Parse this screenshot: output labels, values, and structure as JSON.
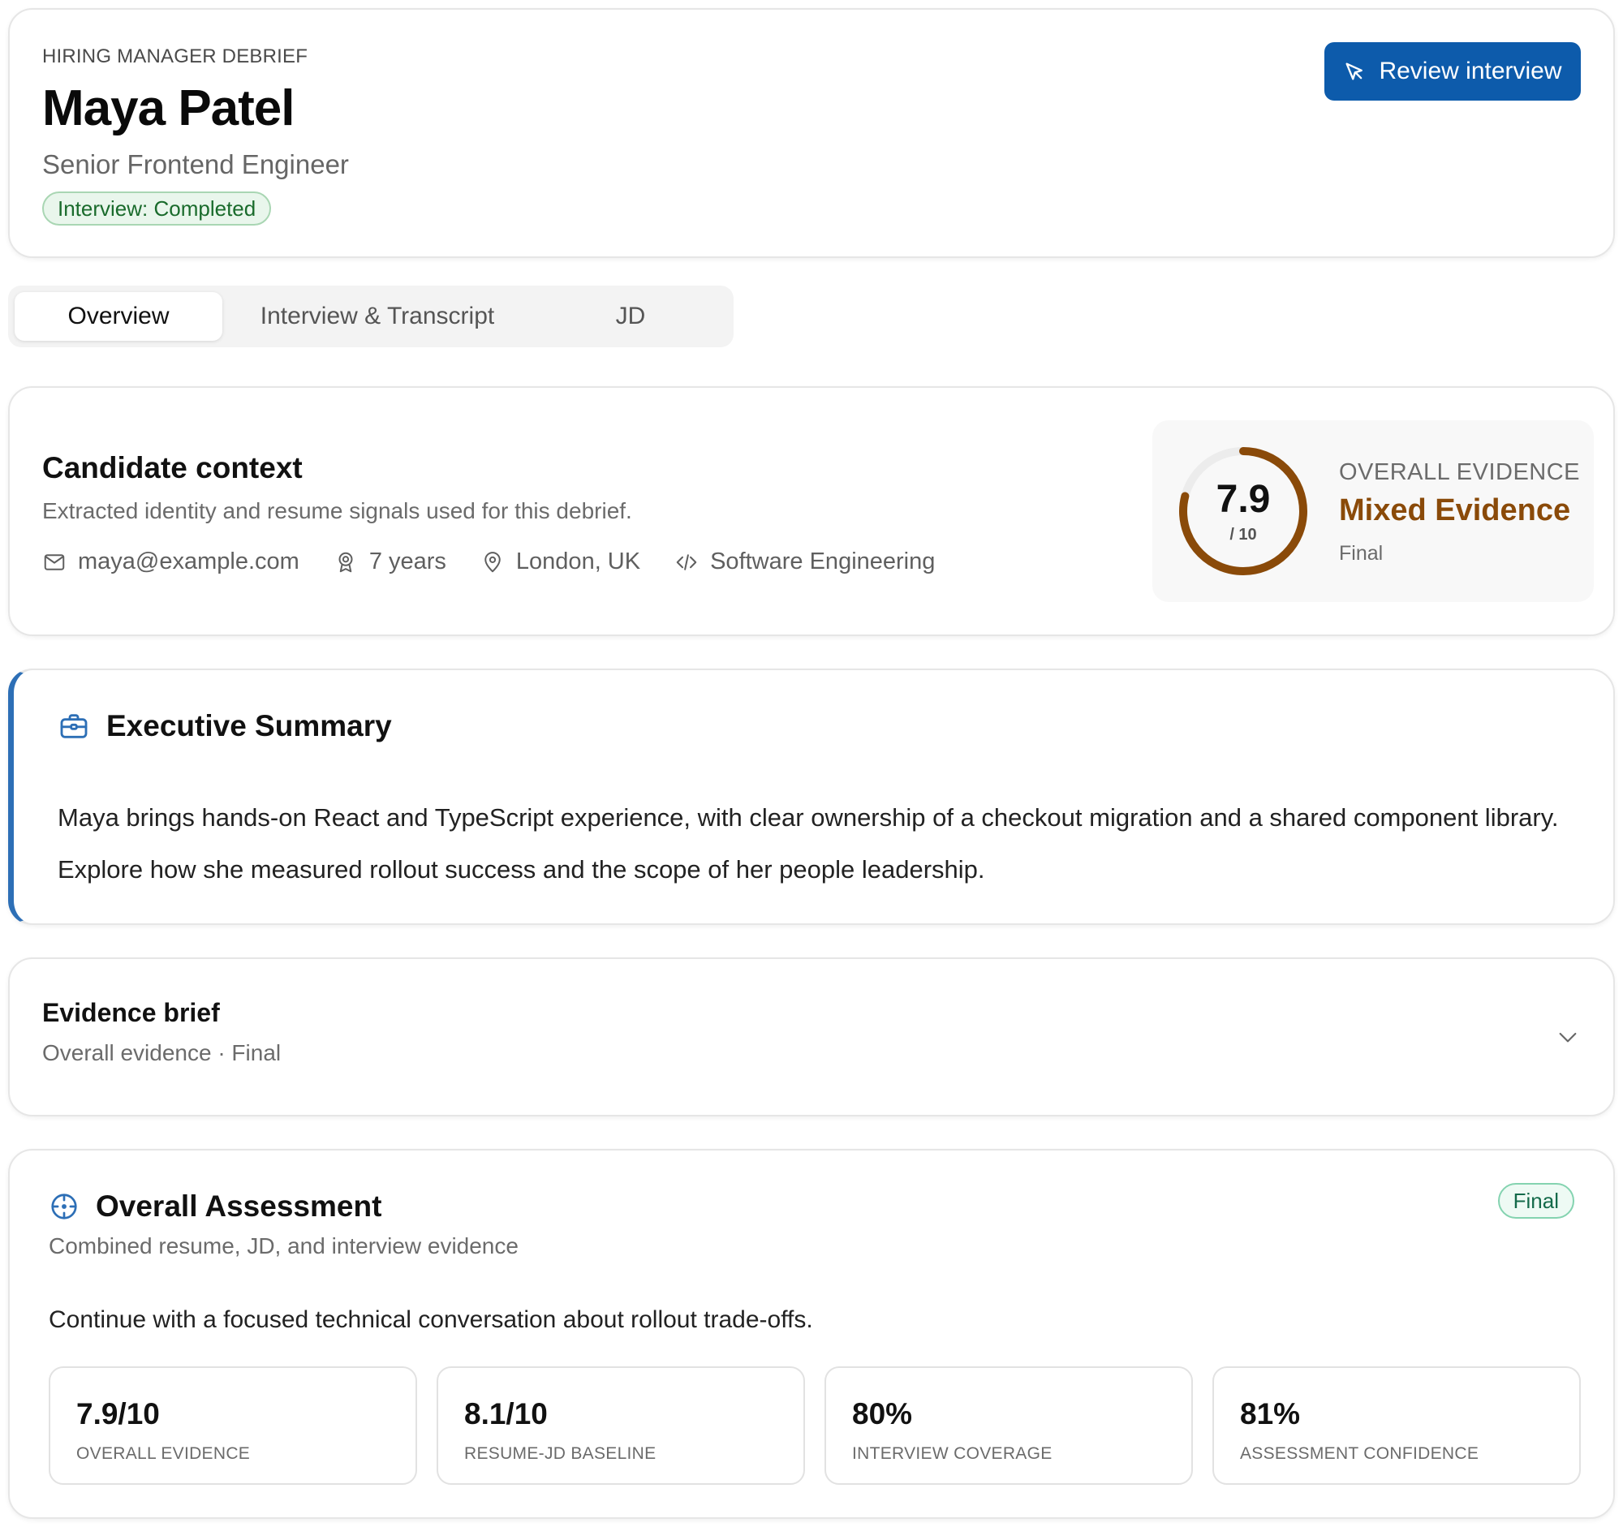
{
  "header": {
    "eyebrow": "HIRING MANAGER DEBRIEF",
    "name": "Maya Patel",
    "role": "Senior Frontend Engineer",
    "status": "Interview: Completed",
    "review_label": "Review interview"
  },
  "tabs": [
    {
      "label": "Overview",
      "active": true
    },
    {
      "label": "Interview & Transcript",
      "active": false
    },
    {
      "label": "JD",
      "active": false
    }
  ],
  "context": {
    "title": "Candidate context",
    "subtitle": "Extracted identity and resume signals used for this debrief.",
    "meta": [
      {
        "icon": "mail-icon",
        "text": "maya@example.com"
      },
      {
        "icon": "award-icon",
        "text": "7 years"
      },
      {
        "icon": "map-pin-icon",
        "text": "London, UK"
      },
      {
        "icon": "code-icon",
        "text": "Software Engineering"
      }
    ]
  },
  "evidence": {
    "score": "7.9",
    "max": "/ 10",
    "score_value": 7.9,
    "score_max": 10,
    "label": "OVERALL EVIDENCE",
    "verdict": "Mixed Evidence",
    "state": "Final",
    "accent": "#8a4a09"
  },
  "summary": {
    "title": "Executive Summary",
    "text": "Maya brings hands-on React and TypeScript experience, with clear ownership of a checkout migration and a shared component library. Explore how she measured rollout success and the scope of her people leadership."
  },
  "brief": {
    "title": "Evidence brief",
    "subtitle": "Overall evidence · Final"
  },
  "assessment": {
    "title": "Overall Assessment",
    "subtitle": "Combined resume, JD, and interview evidence",
    "badge": "Final",
    "recommendation": "Continue with a focused technical conversation about rollout trade-offs.",
    "metrics": [
      {
        "value": "7.9/10",
        "label": "OVERALL EVIDENCE"
      },
      {
        "value": "8.1/10",
        "label": "RESUME-JD BASELINE"
      },
      {
        "value": "80%",
        "label": "INTERVIEW COVERAGE"
      },
      {
        "value": "81%",
        "label": "ASSESSMENT CONFIDENCE"
      }
    ]
  },
  "colors": {
    "primary": "#0d5bab",
    "summary_accent": "#2d6fb6",
    "status_green": "#1a6b2c",
    "final_green": "#146a4a"
  }
}
